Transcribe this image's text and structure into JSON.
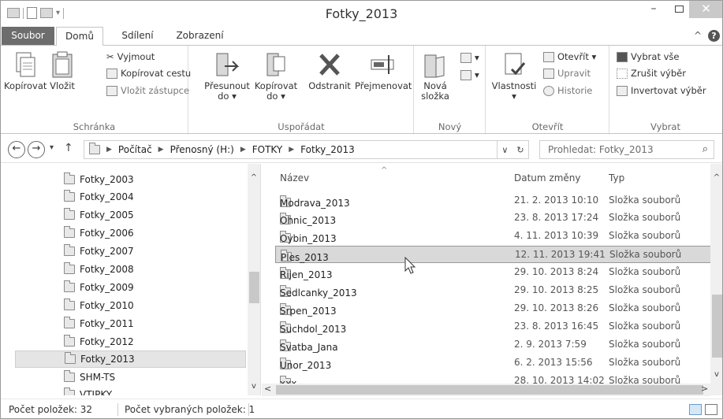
{
  "window": {
    "title": "Fotky_2013",
    "minimize": "–",
    "maximize": "",
    "close": "✕"
  },
  "ribbon_tabs": {
    "file": "Soubor",
    "home": "Domů",
    "share": "Sdílení",
    "view": "Zobrazení",
    "collapse": "^",
    "help": "?"
  },
  "ribbon": {
    "clipboard": {
      "label": "Schránka",
      "copy": "Kopírovat",
      "paste": "Vložit",
      "cut": "Vyjmout",
      "copy_path": "Kopírovat cestu",
      "paste_shortcut": "Vložit zástupce"
    },
    "organize": {
      "label": "Uspořádat",
      "move_to_1": "Přesunout",
      "move_to_2": "do ▾",
      "copy_to_1": "Kopírovat",
      "copy_to_2": "do ▾",
      "delete": "Odstranit",
      "rename": "Přejmenovat"
    },
    "new": {
      "label": "Nový",
      "new_folder_1": "Nová",
      "new_folder_2": "složka"
    },
    "open": {
      "label": "Otevřít",
      "properties": "Vlastnosti",
      "properties_dd": "▾",
      "open": "Otevřít ▾",
      "edit": "Upravit",
      "history": "Historie"
    },
    "select": {
      "label": "Vybrat",
      "select_all": "Vybrat vše",
      "select_none": "Zrušit výběr",
      "invert": "Invertovat výběr"
    }
  },
  "address": {
    "back": "←",
    "forward": "→",
    "recent": "▾",
    "up": "↑",
    "crumbs": [
      "Počítač",
      "Přenosný (H:)",
      "FOTKY",
      "Fotky_2013"
    ],
    "dropdown": "∨",
    "refresh": "↻",
    "search_placeholder": "Prohledat: Fotky_2013"
  },
  "nav_pane": {
    "items": [
      "Fotky_2003",
      "Fotky_2004",
      "Fotky_2005",
      "Fotky_2006",
      "Fotky_2007",
      "Fotky_2008",
      "Fotky_2009",
      "Fotky_2010",
      "Fotky_2011",
      "Fotky_2012",
      "Fotky_2013",
      "SHM-TS",
      "VTIPKY"
    ],
    "selected": "Fotky_2013"
  },
  "file_list": {
    "columns": {
      "name": "Název",
      "date": "Datum změny",
      "type": "Typ"
    },
    "rows": [
      {
        "name": "Modrava_2013",
        "date": "21. 2. 2013 10:10",
        "type": "Složka souborů"
      },
      {
        "name": "Ohnic_2013",
        "date": "23. 8. 2013 17:24",
        "type": "Složka souborů"
      },
      {
        "name": "Oybin_2013",
        "date": "4. 11. 2013 10:39",
        "type": "Složka souborů"
      },
      {
        "name": "Ples_2013",
        "date": "12. 11. 2013 19:41",
        "type": "Složka souborů"
      },
      {
        "name": "Rijen_2013",
        "date": "29. 10. 2013 8:24",
        "type": "Složka souborů"
      },
      {
        "name": "Sedlcanky_2013",
        "date": "29. 10. 2013 8:25",
        "type": "Složka souborů"
      },
      {
        "name": "Srpen_2013",
        "date": "29. 10. 2013 8:26",
        "type": "Složka souborů"
      },
      {
        "name": "Suchdol_2013",
        "date": "23. 8. 2013 16:45",
        "type": "Složka souborů"
      },
      {
        "name": "Svatba_Jana",
        "date": "2. 9. 2013 7:59",
        "type": "Složka souborů"
      },
      {
        "name": "Unor_2013",
        "date": "6. 2. 2013 15:56",
        "type": "Složka souborů"
      },
      {
        "name": "xxx",
        "date": "28. 10. 2013 14:02",
        "type": "Složka souborů"
      }
    ],
    "selected": "Ples_2013"
  },
  "status": {
    "item_count": "Počet položek: 32",
    "selected_count": "Počet vybraných položek: 1"
  }
}
